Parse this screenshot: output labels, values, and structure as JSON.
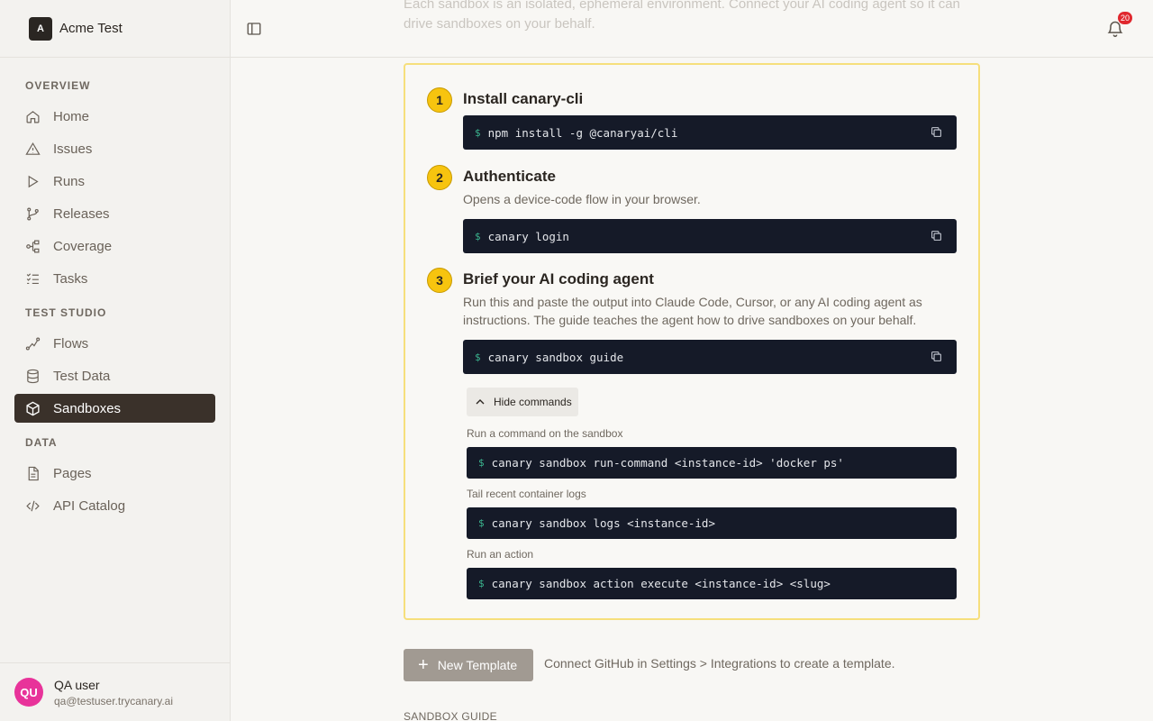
{
  "workspace": {
    "name": "Acme Test",
    "logo_text": "A"
  },
  "sidebar": {
    "sections": [
      {
        "label": "OVERVIEW",
        "items": [
          {
            "label": "Home",
            "icon": "home-icon"
          },
          {
            "label": "Issues",
            "icon": "warning-icon"
          },
          {
            "label": "Runs",
            "icon": "play-icon"
          },
          {
            "label": "Releases",
            "icon": "branch-icon"
          },
          {
            "label": "Coverage",
            "icon": "nodes-icon"
          },
          {
            "label": "Tasks",
            "icon": "checklist-icon"
          }
        ]
      },
      {
        "label": "TEST STUDIO",
        "items": [
          {
            "label": "Flows",
            "icon": "flow-icon"
          },
          {
            "label": "Test Data",
            "icon": "database-icon"
          },
          {
            "label": "Sandboxes",
            "icon": "cube-icon",
            "active": true
          }
        ]
      },
      {
        "label": "DATA",
        "items": [
          {
            "label": "Pages",
            "icon": "document-icon"
          },
          {
            "label": "API Catalog",
            "icon": "code-icon"
          }
        ]
      }
    ]
  },
  "user": {
    "initials": "QU",
    "name": "QA user",
    "email": "qa@testuser.trycanary.ai"
  },
  "header": {
    "notification_count": "20",
    "faded_intro": "Each sandbox is an isolated, ephemeral environment. Connect your AI coding agent so it can drive sandboxes on your behalf."
  },
  "steps": [
    {
      "number": "1",
      "title": "Install canary-cli",
      "description": "",
      "command": "npm install -g @canaryai/cli"
    },
    {
      "number": "2",
      "title": "Authenticate",
      "description": "Opens a device-code flow in your browser.",
      "command": "canary login"
    },
    {
      "number": "3",
      "title": "Brief your AI coding agent",
      "description": "Run this and paste the output into Claude Code, Cursor, or any AI coding agent as instructions. The guide teaches the agent how to drive sandboxes on your behalf.",
      "command": "canary sandbox guide"
    }
  ],
  "prompt_symbol": "$",
  "hide_commands_label": "Hide commands",
  "extra_commands": [
    {
      "label": "Run a command on the sandbox",
      "command": "canary sandbox run-command <instance-id> 'docker ps'"
    },
    {
      "label": "Tail recent container logs",
      "command": "canary sandbox logs <instance-id>"
    },
    {
      "label": "Run an action",
      "command": "canary sandbox action execute <instance-id> <slug>"
    }
  ],
  "new_template": {
    "label": "New Template",
    "note": "Connect GitHub in Settings > Integrations to create a template."
  },
  "guide_heading": "SANDBOX GUIDE",
  "colors": {
    "accent_yellow": "#f7c40f",
    "card_border": "#f6df7c",
    "active_nav": "#3a312a",
    "code_bg": "#151a28",
    "avatar": "#e8339a",
    "badge": "#e0282e"
  }
}
